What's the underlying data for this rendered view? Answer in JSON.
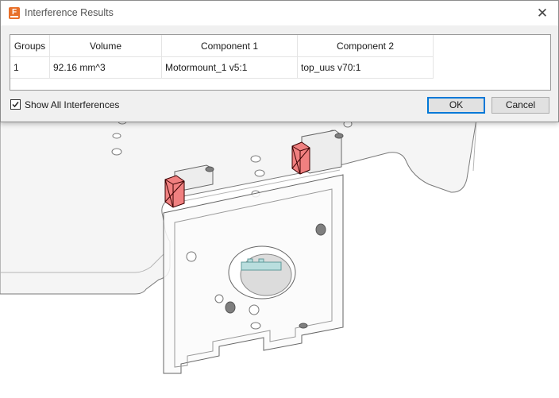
{
  "dialog": {
    "title": "Interference Results",
    "app_icon": "F",
    "close_glyph": "✕",
    "table": {
      "columns": [
        "Groups",
        "Volume",
        "Component 1",
        "Component 2"
      ],
      "rows": [
        [
          "1",
          "92.16 mm^3",
          "Motormount_1 v5:1",
          "top_uus v70:1"
        ]
      ]
    },
    "show_all": {
      "label": "Show All Interferences",
      "checked": true
    },
    "ok_label": "OK",
    "cancel_label": "Cancel"
  },
  "colors": {
    "interference": "#f08080",
    "model_edge": "#6e6e6e",
    "model_face": "#f4f4f4"
  }
}
